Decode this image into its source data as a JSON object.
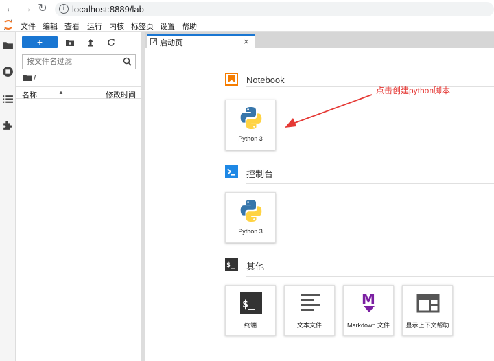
{
  "browser": {
    "url": "localhost:8889/lab"
  },
  "menu": {
    "items": [
      "文件",
      "编辑",
      "查看",
      "运行",
      "内核",
      "标签页",
      "设置",
      "帮助"
    ]
  },
  "filebrowser": {
    "new_label": "+",
    "filter_placeholder": "按文件名过滤",
    "breadcrumb": "/",
    "col_name": "名称",
    "col_modified": "修改时间"
  },
  "tab": {
    "label": "启动页",
    "close": "×"
  },
  "launcher": {
    "sections": [
      {
        "title": "Notebook",
        "cards": [
          {
            "label": "Python 3",
            "icon": "python-logo"
          }
        ]
      },
      {
        "title": "控制台",
        "cards": [
          {
            "label": "Python 3",
            "icon": "python-logo"
          }
        ]
      },
      {
        "title": "其他",
        "cards": [
          {
            "label": "终端",
            "icon": "terminal-icon"
          },
          {
            "label": "文本文件",
            "icon": "text-file-icon"
          },
          {
            "label": "Markdown 文件",
            "icon": "markdown-icon"
          },
          {
            "label": "显示上下文帮助",
            "icon": "context-help-icon"
          }
        ]
      }
    ]
  },
  "annotation": {
    "text": "点击创建python脚本"
  },
  "colors": {
    "accent": "#1976d2",
    "notebook": "#f57c00",
    "console": "#1e88e5",
    "other": "#333333",
    "annotation": "#e53935",
    "markdown": "#7b1fa2"
  }
}
